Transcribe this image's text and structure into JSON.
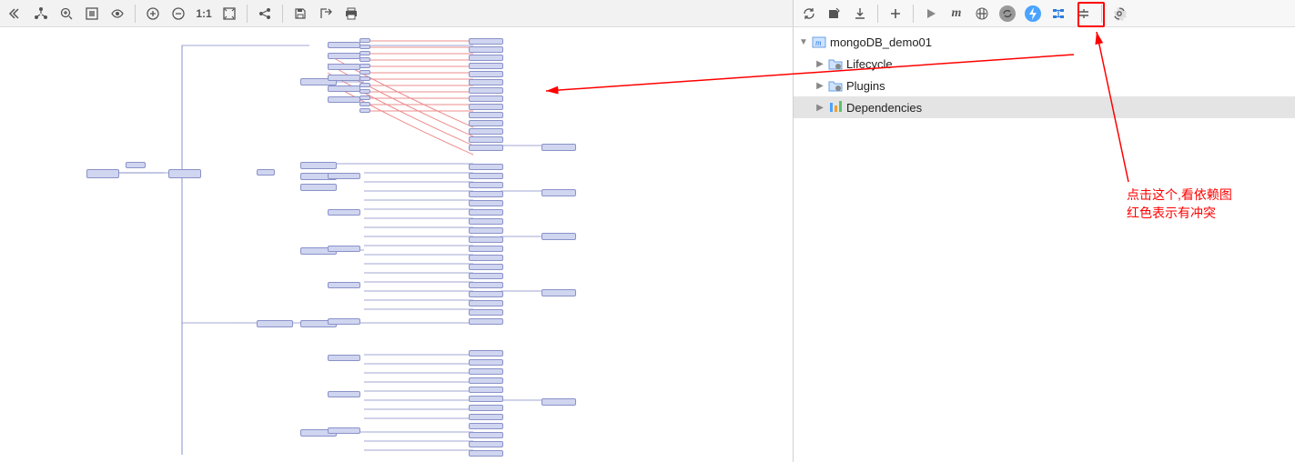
{
  "left_toolbar": {
    "collapse": "Collapse",
    "select": "Select",
    "zoom_in_mag": "Zoom In",
    "fit_content": "Fit Content",
    "eye": "Preview",
    "zoom_in": "Zoom In",
    "zoom_out": "Zoom Out",
    "one_to_one": "1:1",
    "fit_window": "Fit Window",
    "share": "Share",
    "save": "Save",
    "export": "Export",
    "print": "Print",
    "one_to_one_label": "1:1"
  },
  "right_toolbar": {
    "refresh": "Refresh",
    "import": "Import",
    "download": "Download",
    "add": "Add",
    "run": "Run",
    "maven": "m",
    "skip": "Skip Tests",
    "cycle": "Cycle",
    "power": "Power",
    "show_deps": "Show Dependencies",
    "collapse": "Collapse",
    "settings": "Settings"
  },
  "tree": {
    "root": {
      "label": "mongoDB_demo01"
    },
    "children": [
      {
        "label": "Lifecycle"
      },
      {
        "label": "Plugins"
      },
      {
        "label": "Dependencies"
      }
    ]
  },
  "annotation": {
    "line1": "点击这个,看依赖图",
    "line2": "红色表示有冲突"
  }
}
